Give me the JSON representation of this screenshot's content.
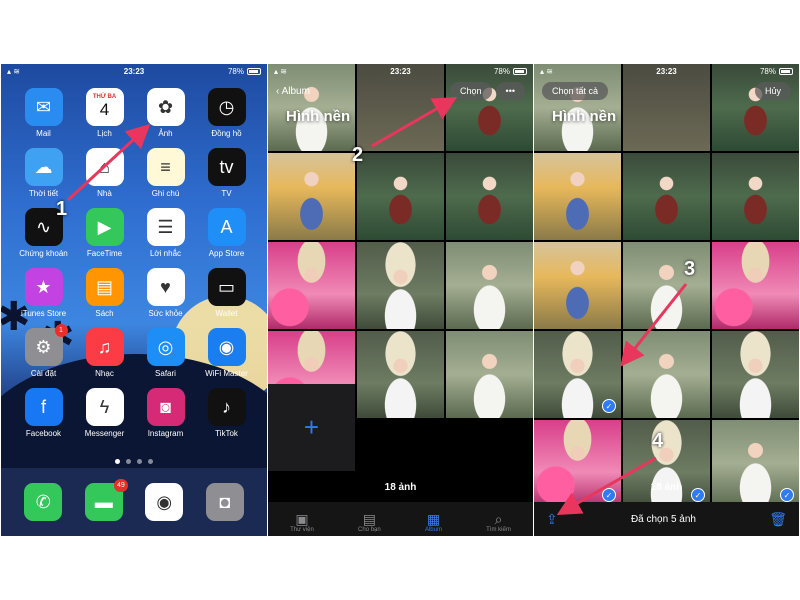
{
  "status": {
    "time": "23:23",
    "battery": "78%"
  },
  "home": {
    "apps": [
      {
        "label": "Mail",
        "icon": "mail-icon",
        "glyph": "✉",
        "color": "#2a8cf0"
      },
      {
        "label": "Lịch",
        "icon": "calendar-icon",
        "glyph": "4",
        "day": "THỨ BA",
        "color": "#ffffff"
      },
      {
        "label": "Ảnh",
        "icon": "photos-icon",
        "glyph": "✿",
        "color": "#ffffff"
      },
      {
        "label": "Đồng hồ",
        "icon": "clock-icon",
        "glyph": "◷",
        "color": "#111111"
      },
      {
        "label": "Thời tiết",
        "icon": "weather-icon",
        "glyph": "☁",
        "color": "#3fa1f2"
      },
      {
        "label": "Nhà",
        "icon": "home-icon",
        "glyph": "⌂",
        "color": "#ffffff"
      },
      {
        "label": "Ghi chú",
        "icon": "notes-icon",
        "glyph": "≡",
        "color": "#fff9d8"
      },
      {
        "label": "TV",
        "icon": "tv-icon",
        "glyph": "tv",
        "color": "#111111"
      },
      {
        "label": "Chứng khoán",
        "icon": "stocks-icon",
        "glyph": "∿",
        "color": "#111111"
      },
      {
        "label": "FaceTime",
        "icon": "facetime-icon",
        "glyph": "▶",
        "color": "#34c759"
      },
      {
        "label": "Lời nhắc",
        "icon": "reminders-icon",
        "glyph": "☰",
        "color": "#ffffff"
      },
      {
        "label": "App Store",
        "icon": "appstore-icon",
        "glyph": "A",
        "color": "#1f8ef6"
      },
      {
        "label": "iTunes Store",
        "icon": "itunes-icon",
        "glyph": "★",
        "color": "#c242e2"
      },
      {
        "label": "Sách",
        "icon": "books-icon",
        "glyph": "▤",
        "color": "#ff9500"
      },
      {
        "label": "Sức khỏe",
        "icon": "health-icon",
        "glyph": "♥",
        "color": "#ffffff"
      },
      {
        "label": "Wallet",
        "icon": "wallet-icon",
        "glyph": "▭",
        "color": "#111111"
      },
      {
        "label": "Cài đặt",
        "icon": "settings-icon",
        "glyph": "⚙",
        "color": "#8e8e93",
        "badge": "1"
      },
      {
        "label": "Nhạc",
        "icon": "music-icon",
        "glyph": "♫",
        "color": "#fc3c44"
      },
      {
        "label": "Safari",
        "icon": "safari-icon",
        "glyph": "◎",
        "color": "#1d8ef6"
      },
      {
        "label": "WiFi Master",
        "icon": "wifi-master-icon",
        "glyph": "◉",
        "color": "#1b7ef0"
      },
      {
        "label": "Facebook",
        "icon": "facebook-icon",
        "glyph": "f",
        "color": "#1877f2"
      },
      {
        "label": "Messenger",
        "icon": "messenger-icon",
        "glyph": "ϟ",
        "color": "#ffffff"
      },
      {
        "label": "Instagram",
        "icon": "instagram-icon",
        "glyph": "◙",
        "color": "#d62976"
      },
      {
        "label": "TikTok",
        "icon": "tiktok-icon",
        "glyph": "♪",
        "color": "#111111"
      }
    ],
    "dock": [
      {
        "icon": "phone-icon",
        "glyph": "✆",
        "color": "#34c759"
      },
      {
        "icon": "messages-icon",
        "glyph": "▬",
        "color": "#34c759",
        "badge": "49"
      },
      {
        "icon": "chrome-icon",
        "glyph": "◉",
        "color": "#ffffff"
      },
      {
        "icon": "camera-icon",
        "glyph": "◘",
        "color": "#8e8e93"
      }
    ]
  },
  "album": {
    "back_label": "Album",
    "title": "Hình nền",
    "select_label": "Chọn",
    "more_label": "•••",
    "count_label": "18 ảnh",
    "tabs": [
      {
        "label": "Thư viện",
        "icon": "library-icon",
        "glyph": "▣"
      },
      {
        "label": "Cho bạn",
        "icon": "for-you-icon",
        "glyph": "▤"
      },
      {
        "label": "Album",
        "icon": "albums-icon",
        "glyph": "▦",
        "active": true
      },
      {
        "label": "Tìm kiếm",
        "icon": "search-icon",
        "glyph": "⌕"
      }
    ]
  },
  "select": {
    "select_all_label": "Chọn tất cả",
    "cancel_label": "Hủy",
    "title": "Hình nền",
    "count_label": "18 ảnh",
    "selected_label": "Đã chọn 5 ảnh"
  },
  "steps": [
    "1",
    "2",
    "3",
    "4"
  ],
  "colors": {
    "accent": "#2f7bf6",
    "arrow": "#e8365d"
  }
}
